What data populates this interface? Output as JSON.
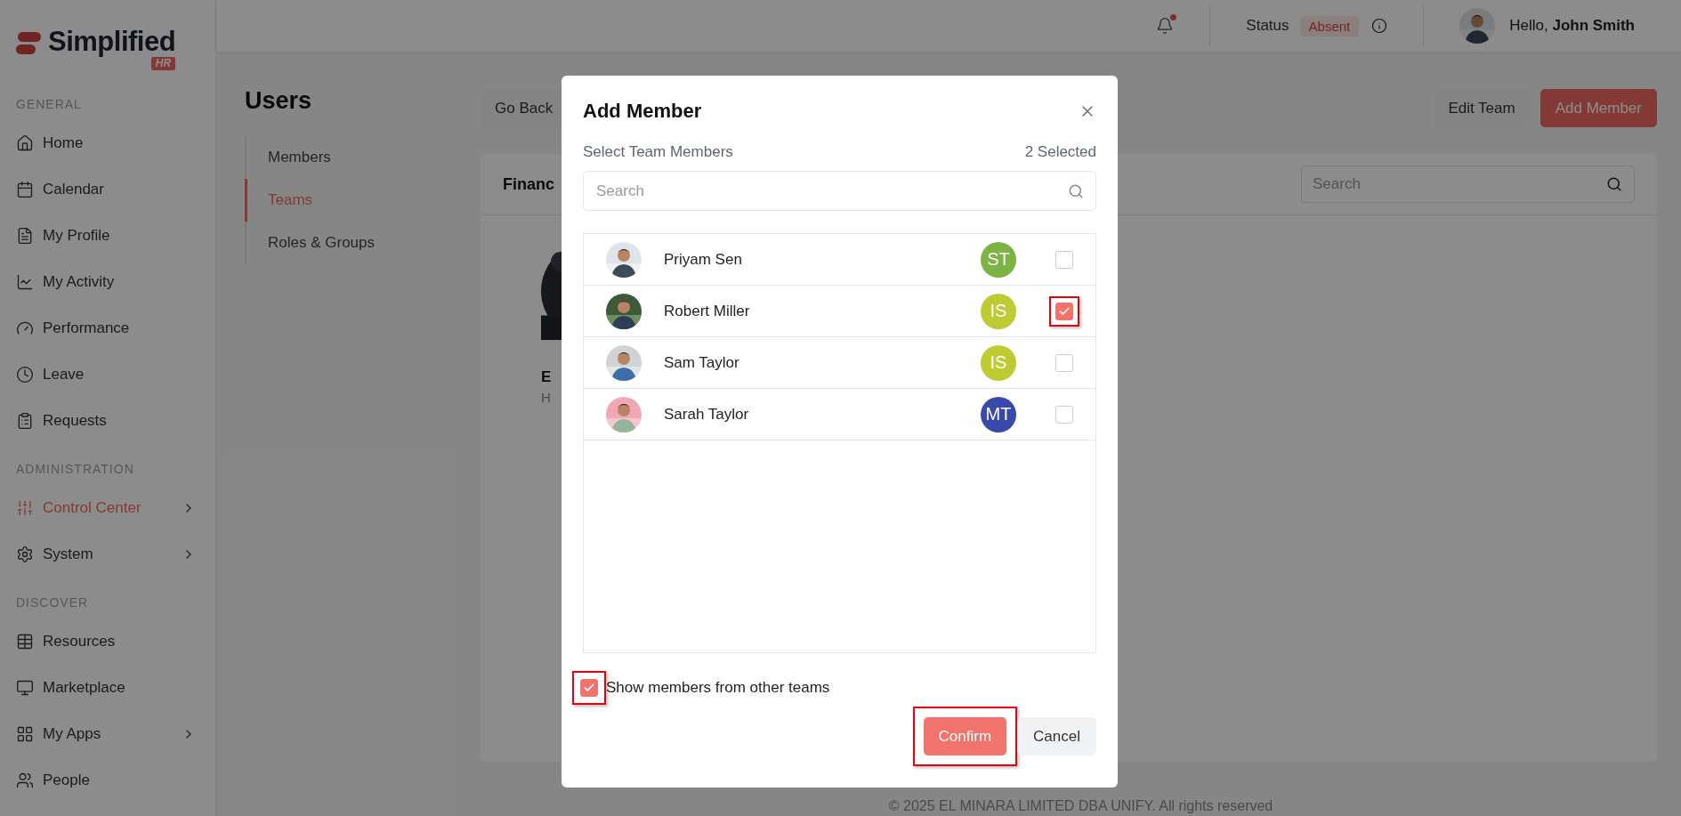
{
  "logo": {
    "name": "Simplified",
    "badge": "HR"
  },
  "sidebar": {
    "sections": [
      {
        "heading": "GENERAL",
        "items": [
          {
            "label": "Home",
            "selected": false,
            "has_submenu": false
          },
          {
            "label": "Calendar",
            "selected": false,
            "has_submenu": false
          },
          {
            "label": "My Profile",
            "selected": false,
            "has_submenu": false
          },
          {
            "label": "My Activity",
            "selected": false,
            "has_submenu": false
          },
          {
            "label": "Performance",
            "selected": false,
            "has_submenu": false
          },
          {
            "label": "Leave",
            "selected": false,
            "has_submenu": false
          },
          {
            "label": "Requests",
            "selected": false,
            "has_submenu": false
          }
        ]
      },
      {
        "heading": "ADMINISTRATION",
        "items": [
          {
            "label": "Control Center",
            "selected": true,
            "has_submenu": true
          },
          {
            "label": "System",
            "selected": false,
            "has_submenu": true
          }
        ]
      },
      {
        "heading": "DISCOVER",
        "items": [
          {
            "label": "Resources",
            "selected": false,
            "has_submenu": false
          },
          {
            "label": "Marketplace",
            "selected": false,
            "has_submenu": false
          },
          {
            "label": "My Apps",
            "selected": false,
            "has_submenu": true
          },
          {
            "label": "People",
            "selected": false,
            "has_submenu": false
          }
        ]
      }
    ]
  },
  "topbar": {
    "notification_dot": true,
    "status_label": "Status",
    "status": "Absent",
    "greeting": "Hello, **John Smith**"
  },
  "users": {
    "title": "Users",
    "nav": [
      {
        "label": "Members",
        "selected": false
      },
      {
        "label": "Teams",
        "selected": true
      },
      {
        "label": "Roles & Groups",
        "selected": false
      }
    ]
  },
  "toolbar": {
    "back": "Go Back",
    "edit": "Edit Team",
    "add": "Add Member"
  },
  "team_card": {
    "title": "Financ",
    "search_placeholder": "Search",
    "member": {
      "name": "E",
      "role": "H"
    }
  },
  "footer": "© 2025 EL MINARA LIMITED DBA UNIFY. All rights reserved",
  "modal": {
    "title": "Add Member",
    "subtitle": "Select Team Members",
    "count": "2 Selected",
    "search_placeholder": "Search",
    "members": [
      {
        "name": "Priyam Sen",
        "initials": "ST",
        "color": "#7cb342",
        "checked": false,
        "highlighted": false
      },
      {
        "name": "Robert Miller",
        "initials": "IS",
        "color": "#c0ca33",
        "checked": true,
        "highlighted": true
      },
      {
        "name": "Sam Taylor",
        "initials": "IS",
        "color": "#c0ca33",
        "checked": false,
        "highlighted": false
      },
      {
        "name": "Sarah Taylor",
        "initials": "MT",
        "color": "#3949ab",
        "checked": false,
        "highlighted": false
      }
    ],
    "show_other_teams": {
      "label": "Show members from other teams",
      "checked": true,
      "highlighted": true
    },
    "confirm": {
      "label": "Confirm",
      "highlighted": true
    },
    "cancel": "Cancel"
  }
}
